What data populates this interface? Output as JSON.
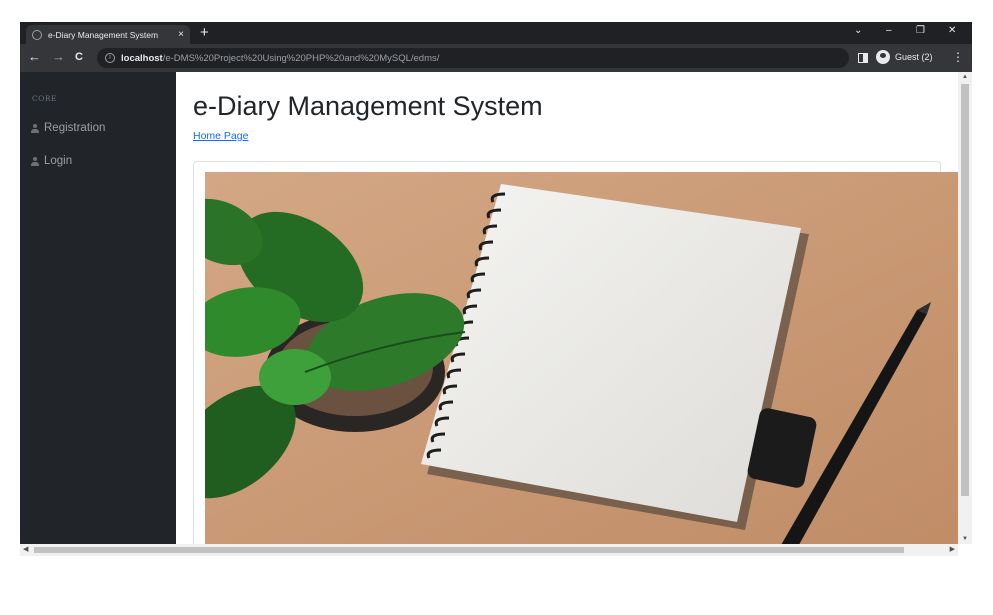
{
  "browser": {
    "tab_title": "e-Diary Management System",
    "tab_close": "×",
    "new_tab": "+",
    "controls": {
      "dropdown": "⌄",
      "minimize": "–",
      "restore": "❐",
      "close": "✕"
    },
    "nav": {
      "back": "←",
      "forward": "→",
      "reload": "C"
    },
    "url_host": "localhost",
    "url_path": "/e-DMS%20Project%20Using%20PHP%20and%20MySQL/edms/",
    "profile_label": "Guest (2)",
    "menu": "⋮"
  },
  "sidebar": {
    "heading": "CORE",
    "items": [
      {
        "label": "Registration",
        "icon": "user-icon"
      },
      {
        "label": "Login",
        "icon": "user-icon"
      }
    ]
  },
  "main": {
    "title": "e-Diary Management System",
    "link": "Home Page"
  },
  "colors": {
    "browser_bg": "#202124",
    "toolbar_bg": "#35363a",
    "sidebar_bg": "#212529",
    "link": "#0d6efd",
    "desk": "#c99772"
  }
}
